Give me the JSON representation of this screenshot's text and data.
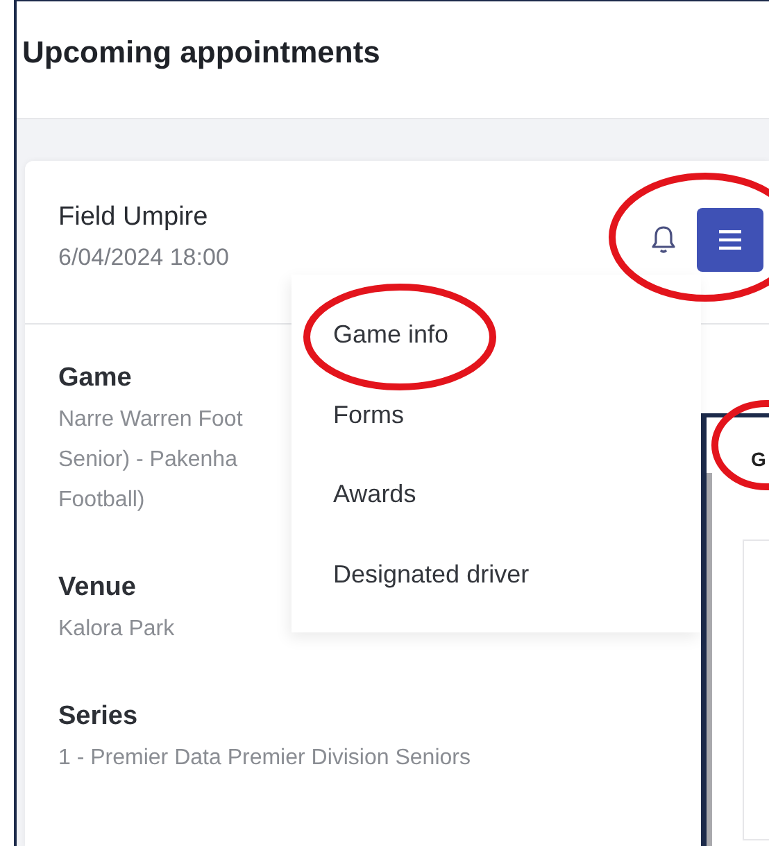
{
  "page": {
    "title": "Upcoming appointments"
  },
  "appointment": {
    "role": "Field Umpire",
    "datetime": "6/04/2024 18:00",
    "details": [
      {
        "label": "Game",
        "lines": [
          "Narre Warren Foot",
          "Senior) - Pakenha",
          "Football)"
        ]
      },
      {
        "label": "Venue",
        "lines": [
          "Kalora Park"
        ]
      },
      {
        "label": "Series",
        "lines": [
          "1 - Premier Data Premier Division Seniors"
        ]
      }
    ]
  },
  "menu": {
    "expanded": true,
    "items": [
      {
        "label": "Game info"
      },
      {
        "label": "Forms"
      },
      {
        "label": "Awards"
      },
      {
        "label": "Designated driver"
      }
    ]
  },
  "side_panel": {
    "title": "G"
  }
}
